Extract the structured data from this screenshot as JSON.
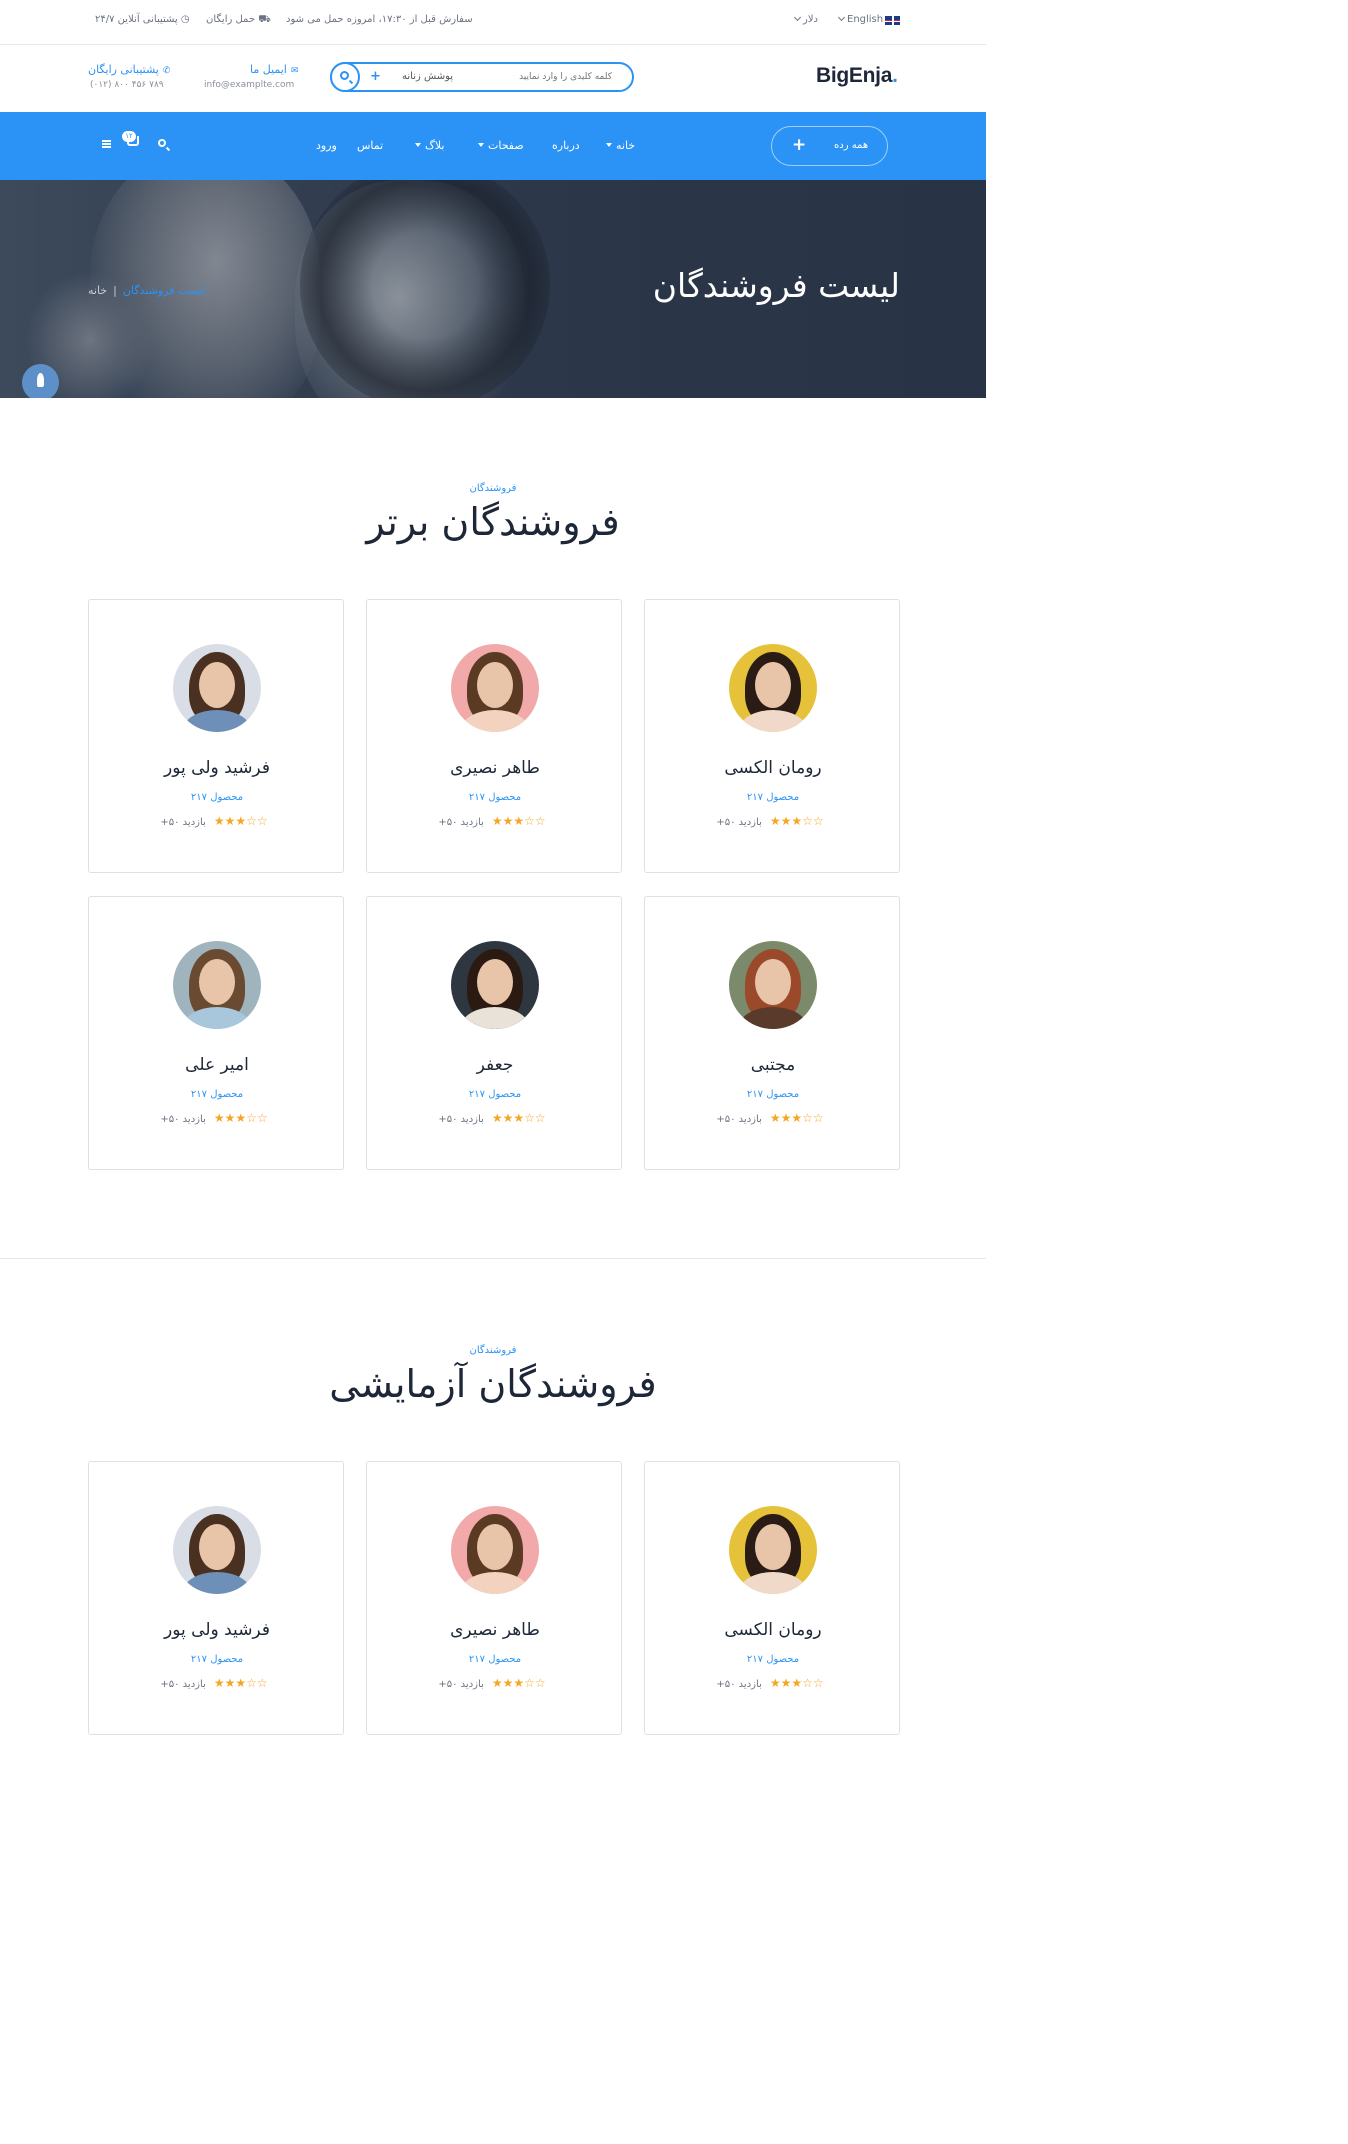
{
  "topbar": {
    "language": "English",
    "currency": "دلار",
    "order_notice": "سفارش قبل از ۱۷:۳۰، امروزه حمل می شود",
    "free_shipping": "حمل رایگان",
    "support_online": "۲۴/۷ پشتیبانی آنلاین"
  },
  "header": {
    "logo_text": "BigEnja",
    "logo_dot": ".",
    "search_placeholder": "کلمه کلیدی را وارد نمایید",
    "search_category": "پوشش زنانه",
    "plus": "+",
    "email_label": "ایمیل ما",
    "email_value": "info@examplte.com",
    "support_label": "پشتیبانی رایگان",
    "support_phone": "(۰۱۲) ۸۰۰ ۴۵۶ ۷۸۹"
  },
  "nav": {
    "all_categories": "همه رده",
    "all_plus": "+",
    "items": [
      "خانه",
      "درباره",
      "صفحات",
      "بلاگ",
      "تماس",
      "ورود"
    ],
    "cart_count": "۱۲"
  },
  "hero": {
    "title": "لیست فروشندگان",
    "breadcrumb_home": "خانه",
    "breadcrumb_sep": "|",
    "breadcrumb_current": "لیست فروشندگان"
  },
  "section_top": {
    "subtitle": "فروشندگان",
    "title": "فروشندگان برتر"
  },
  "section_trial": {
    "subtitle": "فروشندگان",
    "title": "فروشندگان آزمایشی"
  },
  "vendors": [
    {
      "name": "رومان الکسی",
      "products": "۲۱۷ محصول",
      "visits": "+۵۰ بازدید",
      "rating": 3.5
    },
    {
      "name": "طاهر نصیری",
      "products": "۲۱۷ محصول",
      "visits": "+۵۰ بازدید",
      "rating": 3.5
    },
    {
      "name": "فرشید ولی پور",
      "products": "۲۱۷ محصول",
      "visits": "+۵۰ بازدید",
      "rating": 3.5
    },
    {
      "name": "مجتبی",
      "products": "۲۱۷ محصول",
      "visits": "+۵۰ بازدید",
      "rating": 3.5
    },
    {
      "name": "جعفر",
      "products": "۲۱۷ محصول",
      "visits": "+۵۰ بازدید",
      "rating": 3.5
    },
    {
      "name": "امیر علی",
      "products": "۲۱۷ محصول",
      "visits": "+۵۰ بازدید",
      "rating": 3.5
    }
  ],
  "colors": {
    "accent": "#2b93f5",
    "dark": "#1e2737",
    "star": "#f5a623"
  }
}
